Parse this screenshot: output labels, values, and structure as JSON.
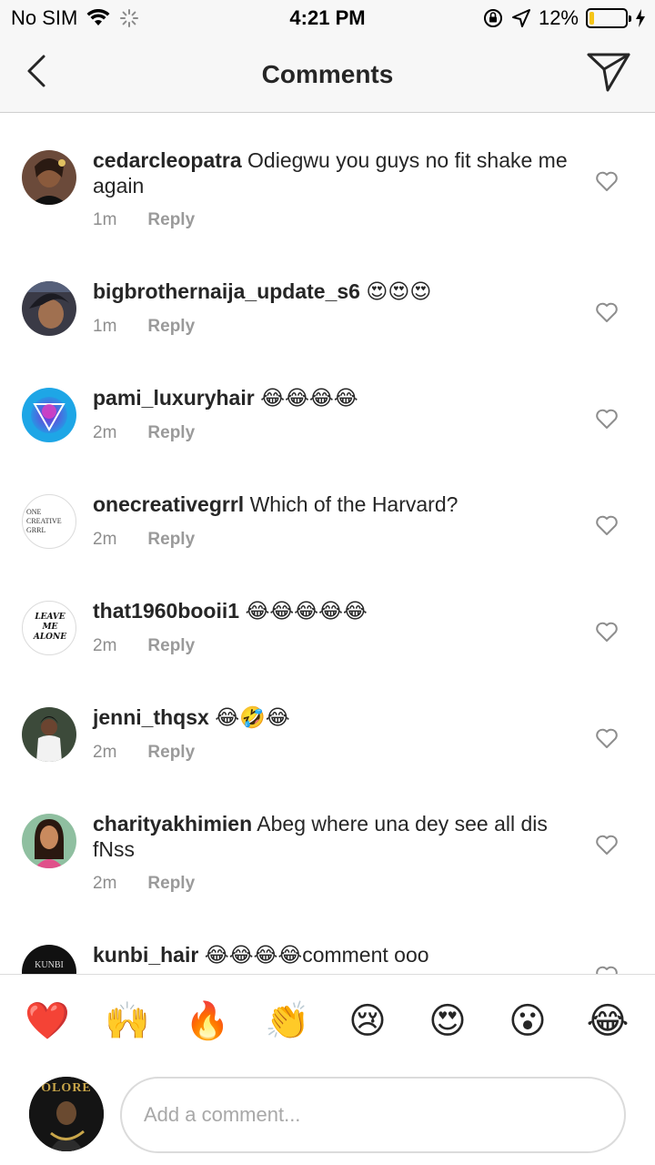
{
  "status_bar": {
    "carrier": "No SIM",
    "time": "4:21 PM",
    "battery_percent": "12%",
    "battery_level": 0.12,
    "icons": [
      "wifi-icon",
      "activity-spinner-icon",
      "orientation-lock-icon",
      "location-arrow-icon",
      "battery-icon",
      "charging-bolt-icon"
    ]
  },
  "nav": {
    "title": "Comments",
    "back_icon": "chevron-left-icon",
    "share_icon": "paper-plane-icon"
  },
  "comments": [
    {
      "username": "cedarcleopatra",
      "text": "Odiegwu you guys no fit shake me again",
      "time": "1m",
      "reply": "Reply"
    },
    {
      "username": "bigbrothernaija_update_s6",
      "text": "😍😍😍",
      "time": "1m",
      "reply": "Reply"
    },
    {
      "username": "pami_luxuryhair",
      "text": "😂😂😂😂",
      "time": "2m",
      "reply": "Reply"
    },
    {
      "username": "onecreativegrrl",
      "text": "Which of the Harvard?",
      "time": "2m",
      "reply": "Reply",
      "avatar_text": "ONE CREATIVE GRRL"
    },
    {
      "username": "that1960booii1",
      "text": "😂😂😂😂😂",
      "time": "2m",
      "reply": "Reply",
      "avatar_text": "LEAVE ME ALONE"
    },
    {
      "username": "jenni_thqsx",
      "text": "😂🤣😂",
      "time": "2m",
      "reply": "Reply"
    },
    {
      "username": "charityakhimien",
      "text": "Abeg where una dey see all dis fNss",
      "time": "2m",
      "reply": "Reply"
    },
    {
      "username": "kunbi_hair",
      "text": "😂😂😂😂comment ooo",
      "time": "",
      "reply": "",
      "avatar_text": "KUNBI"
    }
  ],
  "quick_emojis": [
    "❤️",
    "🙌",
    "🔥",
    "👏",
    "😢",
    "😍",
    "😮",
    "😂"
  ],
  "composer": {
    "placeholder": "Add a comment...",
    "avatar_text": "OLORE"
  },
  "colors": {
    "bar_background": "#f7f7f7",
    "text_primary": "#262626",
    "text_secondary": "#8e8e8e",
    "battery_fill": "#f5c518"
  }
}
